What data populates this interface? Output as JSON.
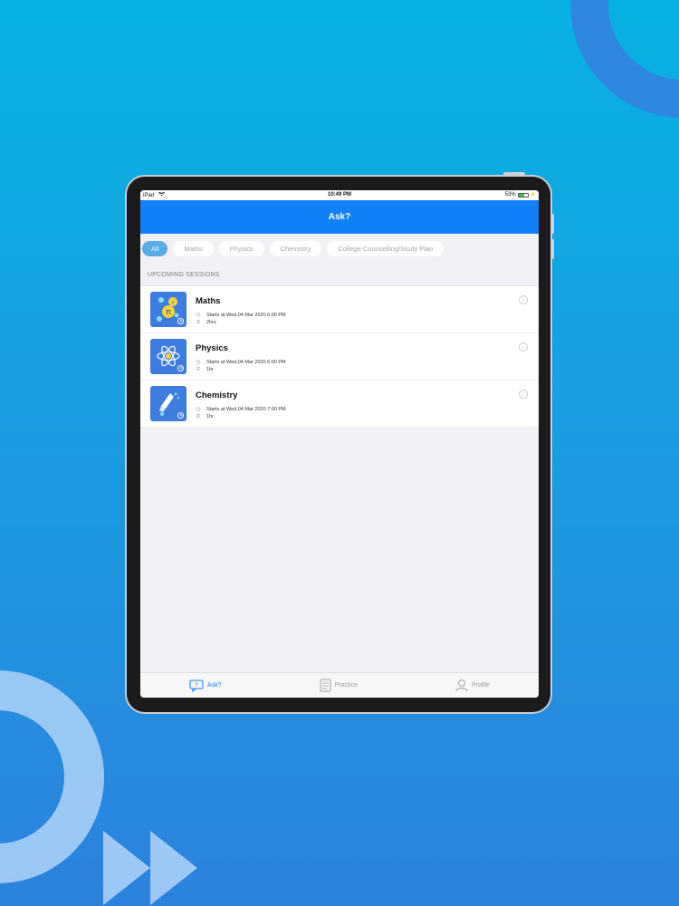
{
  "status_bar": {
    "device": "iPad",
    "time": "10:49 PM",
    "battery": "53%",
    "icons": [
      "wifi-icon",
      "battery-icon"
    ]
  },
  "navbar": {
    "title": "Ask?"
  },
  "filters": [
    {
      "label": "All",
      "active": true
    },
    {
      "label": "Maths",
      "active": false
    },
    {
      "label": "Physics",
      "active": false
    },
    {
      "label": "Chemistry",
      "active": false
    },
    {
      "label": "College Counselling/Study Plan",
      "active": false
    }
  ],
  "section": {
    "title": "UPCOMING SESSIONS"
  },
  "sessions": [
    {
      "title": "Maths",
      "starts": "Starts at Wed,04 Mar 2020 6:00 PM",
      "duration": "2hrs",
      "icon": "maths-icon"
    },
    {
      "title": "Physics",
      "starts": "Starts at Wed,04 Mar 2020 6:00 PM",
      "duration": "1hr",
      "icon": "atom-icon"
    },
    {
      "title": "Chemistry",
      "starts": "Starts at Wed,04 Mar 2020 7:00 PM",
      "duration": "1hr",
      "icon": "flask-icon"
    }
  ],
  "tabbar": [
    {
      "label": "Ask?",
      "icon": "ask-icon",
      "active": true
    },
    {
      "label": "Practice",
      "icon": "practice-icon",
      "active": false
    },
    {
      "label": "Profile",
      "icon": "profile-icon",
      "active": false
    }
  ],
  "colors": {
    "accent": "#1081f8",
    "chip_active": "#5aaee6",
    "thumb_bg": "#3e7ce0",
    "background_top": "#06b2e2",
    "background_bottom": "#2b82dd"
  }
}
